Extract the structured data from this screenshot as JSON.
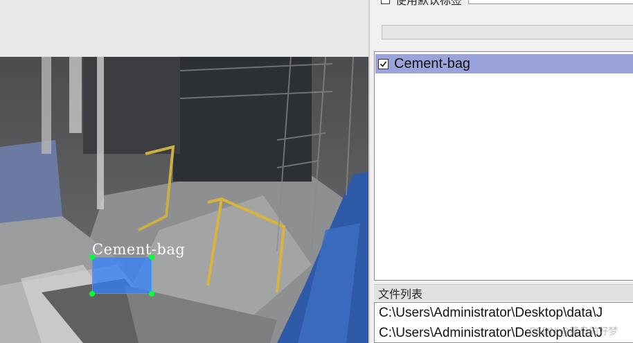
{
  "canvas": {
    "annotation": {
      "label": "Cement-bag",
      "box_color": "#3080ff",
      "handle_color": "#00ff33"
    }
  },
  "panel": {
    "default_label_text": "使用默认标签",
    "labels": [
      {
        "name": "Cement-bag",
        "checked": true
      }
    ],
    "file_list_title": "文件列表",
    "files": [
      "C:\\Users\\Administrator\\Desktop\\data\\J",
      "C:\\Users\\Administrator\\Desktop\\data\\J"
    ],
    "watermark": "CSDN @菜鸟的好梦"
  },
  "colors": {
    "selected_row": "#9aa4da",
    "canvas_bg": "#e8e8e8"
  }
}
